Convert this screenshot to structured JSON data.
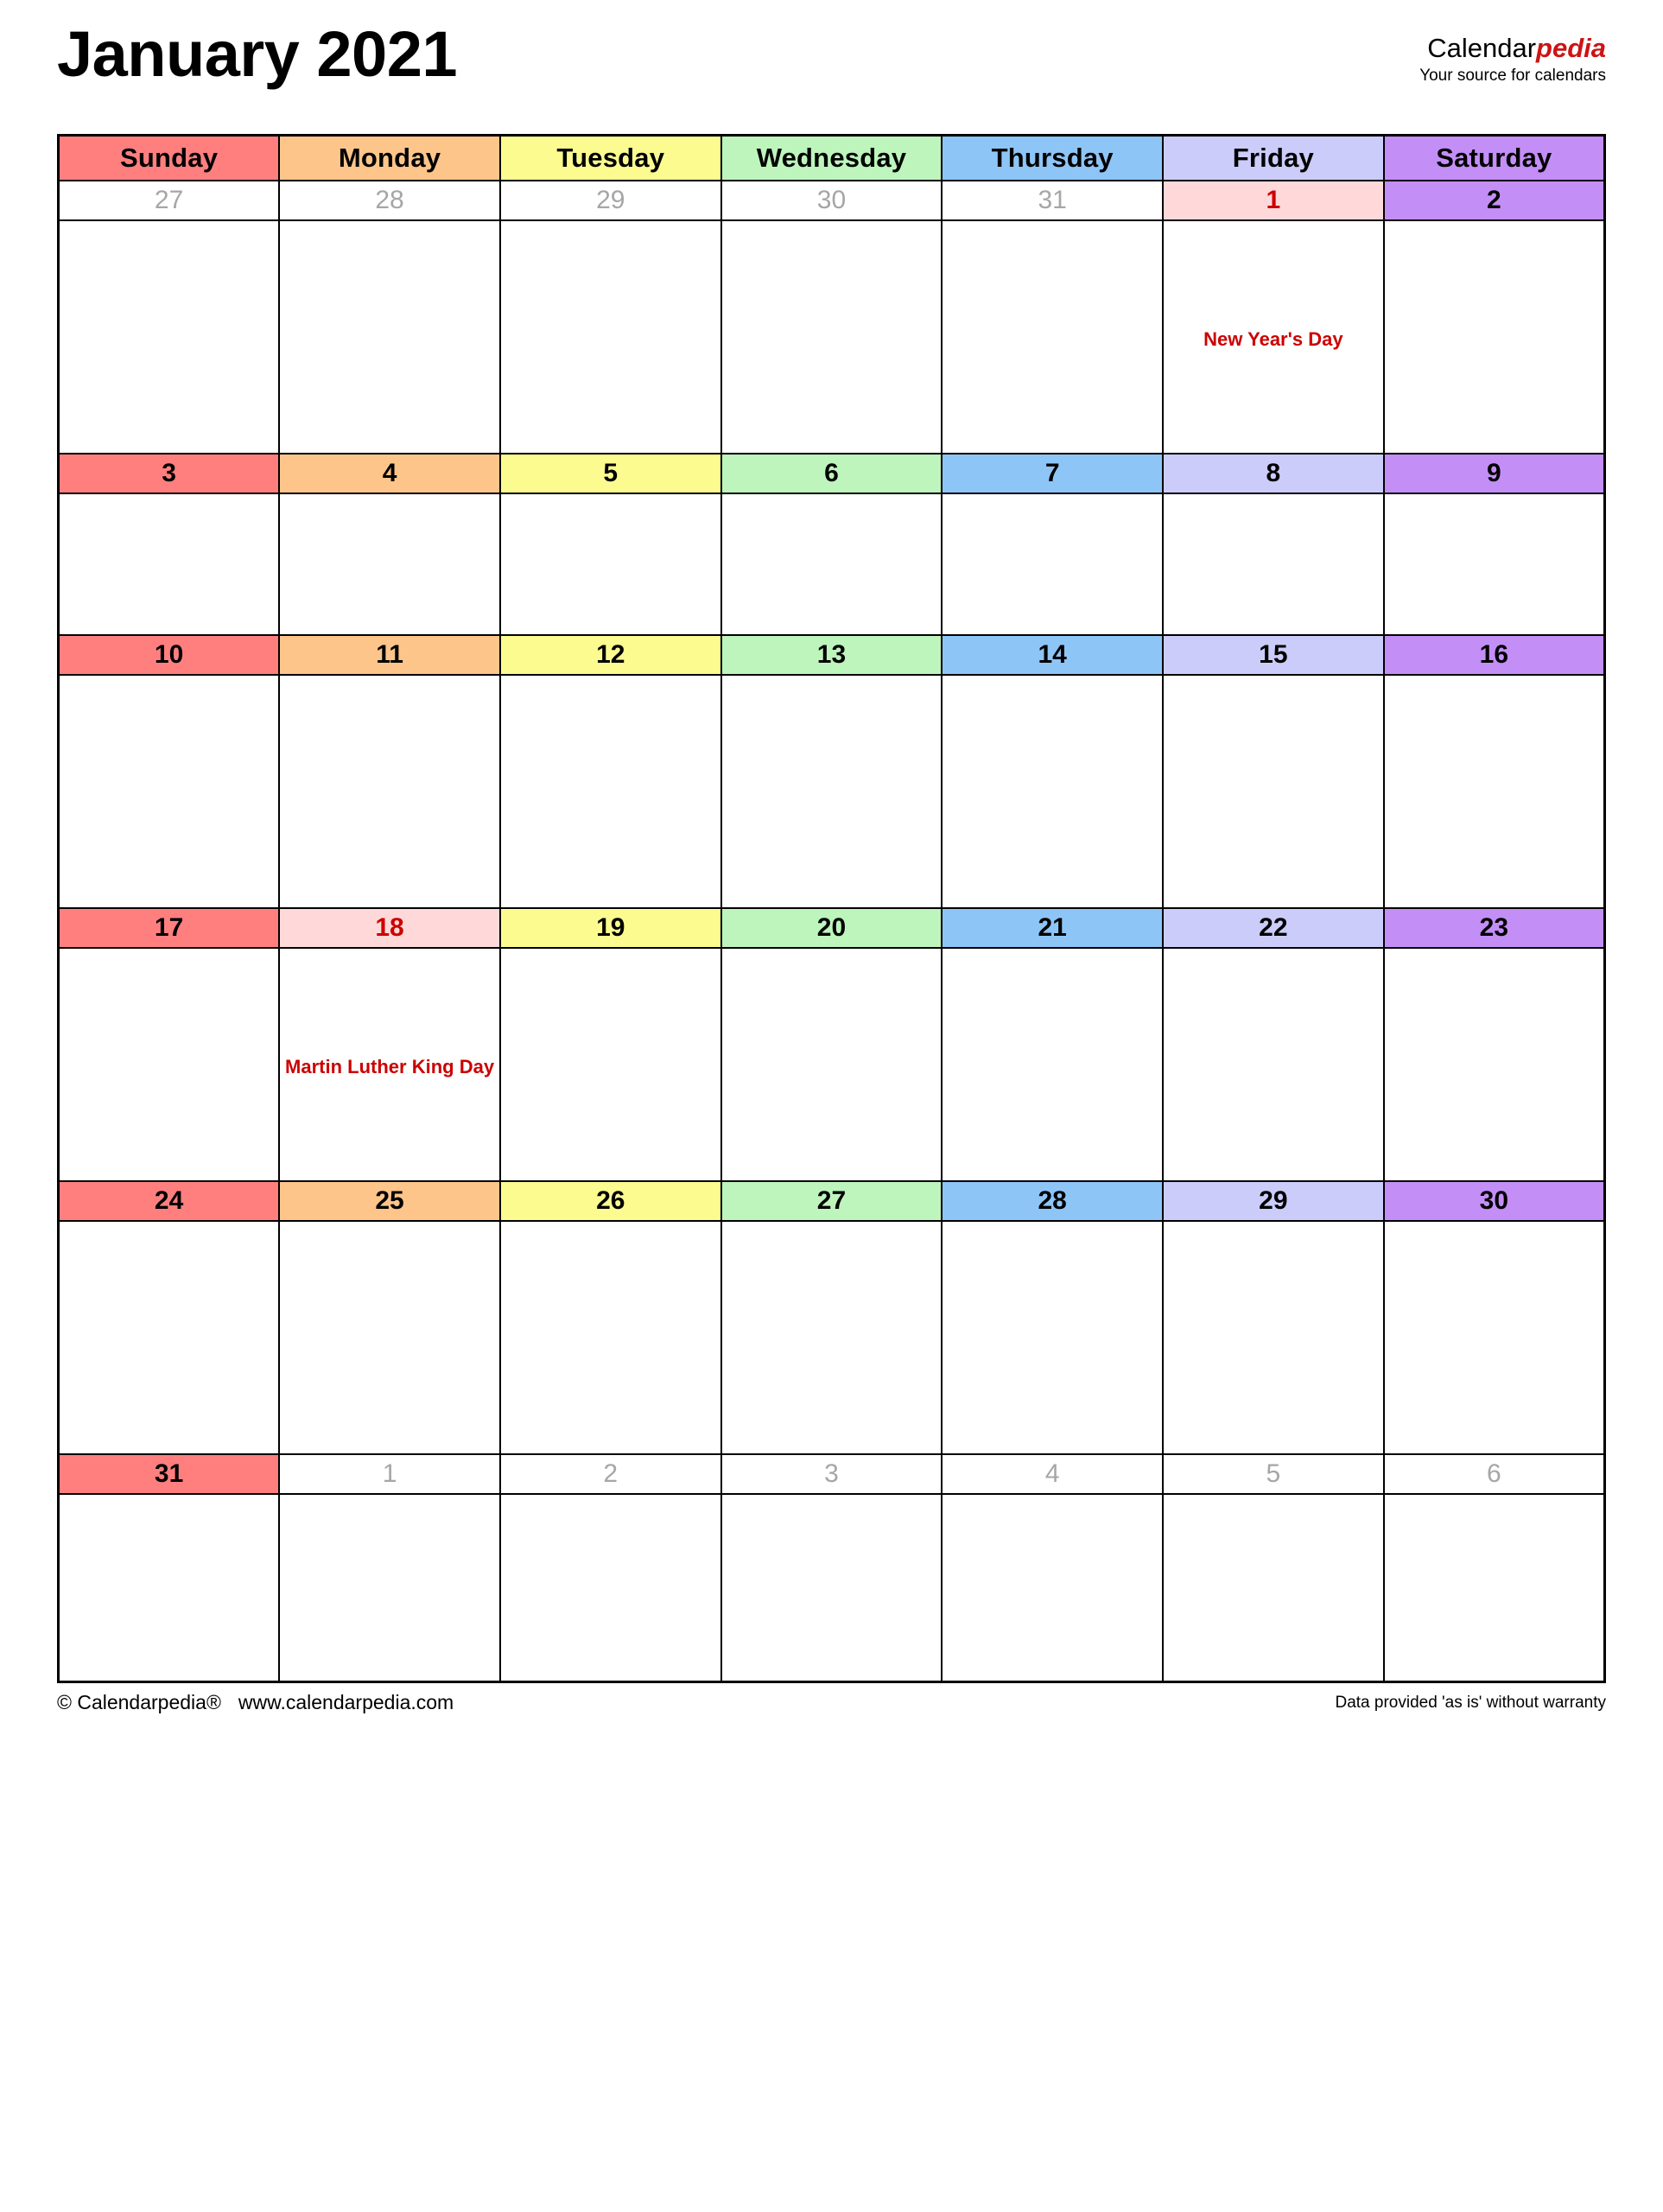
{
  "header": {
    "title": "January 2021",
    "brand_name_black": "Calendar",
    "brand_name_red": "pedia",
    "brand_tagline": "Your source for calendars"
  },
  "weekdays": [
    {
      "label": "Sunday",
      "color": "#ff7f7f"
    },
    {
      "label": "Monday",
      "color": "#fdc58a"
    },
    {
      "label": "Tuesday",
      "color": "#fbfb90"
    },
    {
      "label": "Wednesday",
      "color": "#bdf5bd"
    },
    {
      "label": "Thursday",
      "color": "#8ec5f7"
    },
    {
      "label": "Friday",
      "color": "#ccccfa"
    },
    {
      "label": "Saturday",
      "color": "#c48ef7"
    }
  ],
  "holiday_colors": {
    "background": "#ffd9d9",
    "text": "#cc0000"
  },
  "other_month_text_color": "#a6a6a6",
  "weeks": [
    {
      "days": [
        {
          "num": "27",
          "other": true,
          "event": ""
        },
        {
          "num": "28",
          "other": true,
          "event": ""
        },
        {
          "num": "29",
          "other": true,
          "event": ""
        },
        {
          "num": "30",
          "other": true,
          "event": ""
        },
        {
          "num": "31",
          "other": true,
          "event": ""
        },
        {
          "num": "1",
          "other": false,
          "holiday": true,
          "event": "New Year's Day"
        },
        {
          "num": "2",
          "other": false,
          "event": ""
        }
      ]
    },
    {
      "days": [
        {
          "num": "3",
          "other": false,
          "event": ""
        },
        {
          "num": "4",
          "other": false,
          "event": ""
        },
        {
          "num": "5",
          "other": false,
          "event": ""
        },
        {
          "num": "6",
          "other": false,
          "event": ""
        },
        {
          "num": "7",
          "other": false,
          "event": ""
        },
        {
          "num": "8",
          "other": false,
          "event": ""
        },
        {
          "num": "9",
          "other": false,
          "event": ""
        }
      ]
    },
    {
      "days": [
        {
          "num": "10",
          "other": false,
          "event": ""
        },
        {
          "num": "11",
          "other": false,
          "event": ""
        },
        {
          "num": "12",
          "other": false,
          "event": ""
        },
        {
          "num": "13",
          "other": false,
          "event": ""
        },
        {
          "num": "14",
          "other": false,
          "event": ""
        },
        {
          "num": "15",
          "other": false,
          "event": ""
        },
        {
          "num": "16",
          "other": false,
          "event": ""
        }
      ]
    },
    {
      "days": [
        {
          "num": "17",
          "other": false,
          "event": ""
        },
        {
          "num": "18",
          "other": false,
          "holiday": true,
          "event": "Martin Luther King Day"
        },
        {
          "num": "19",
          "other": false,
          "event": ""
        },
        {
          "num": "20",
          "other": false,
          "event": ""
        },
        {
          "num": "21",
          "other": false,
          "event": ""
        },
        {
          "num": "22",
          "other": false,
          "event": ""
        },
        {
          "num": "23",
          "other": false,
          "event": ""
        }
      ]
    },
    {
      "days": [
        {
          "num": "24",
          "other": false,
          "event": ""
        },
        {
          "num": "25",
          "other": false,
          "event": ""
        },
        {
          "num": "26",
          "other": false,
          "event": ""
        },
        {
          "num": "27",
          "other": false,
          "event": ""
        },
        {
          "num": "28",
          "other": false,
          "event": ""
        },
        {
          "num": "29",
          "other": false,
          "event": ""
        },
        {
          "num": "30",
          "other": false,
          "event": ""
        }
      ]
    },
    {
      "days": [
        {
          "num": "31",
          "other": false,
          "event": ""
        },
        {
          "num": "1",
          "other": true,
          "event": ""
        },
        {
          "num": "2",
          "other": true,
          "event": ""
        },
        {
          "num": "3",
          "other": true,
          "event": ""
        },
        {
          "num": "4",
          "other": true,
          "event": ""
        },
        {
          "num": "5",
          "other": true,
          "event": ""
        },
        {
          "num": "6",
          "other": true,
          "event": ""
        }
      ]
    }
  ],
  "footer": {
    "copyright": "© Calendarpedia®",
    "website": "www.calendarpedia.com",
    "disclaimer": "Data provided 'as is' without warranty"
  }
}
